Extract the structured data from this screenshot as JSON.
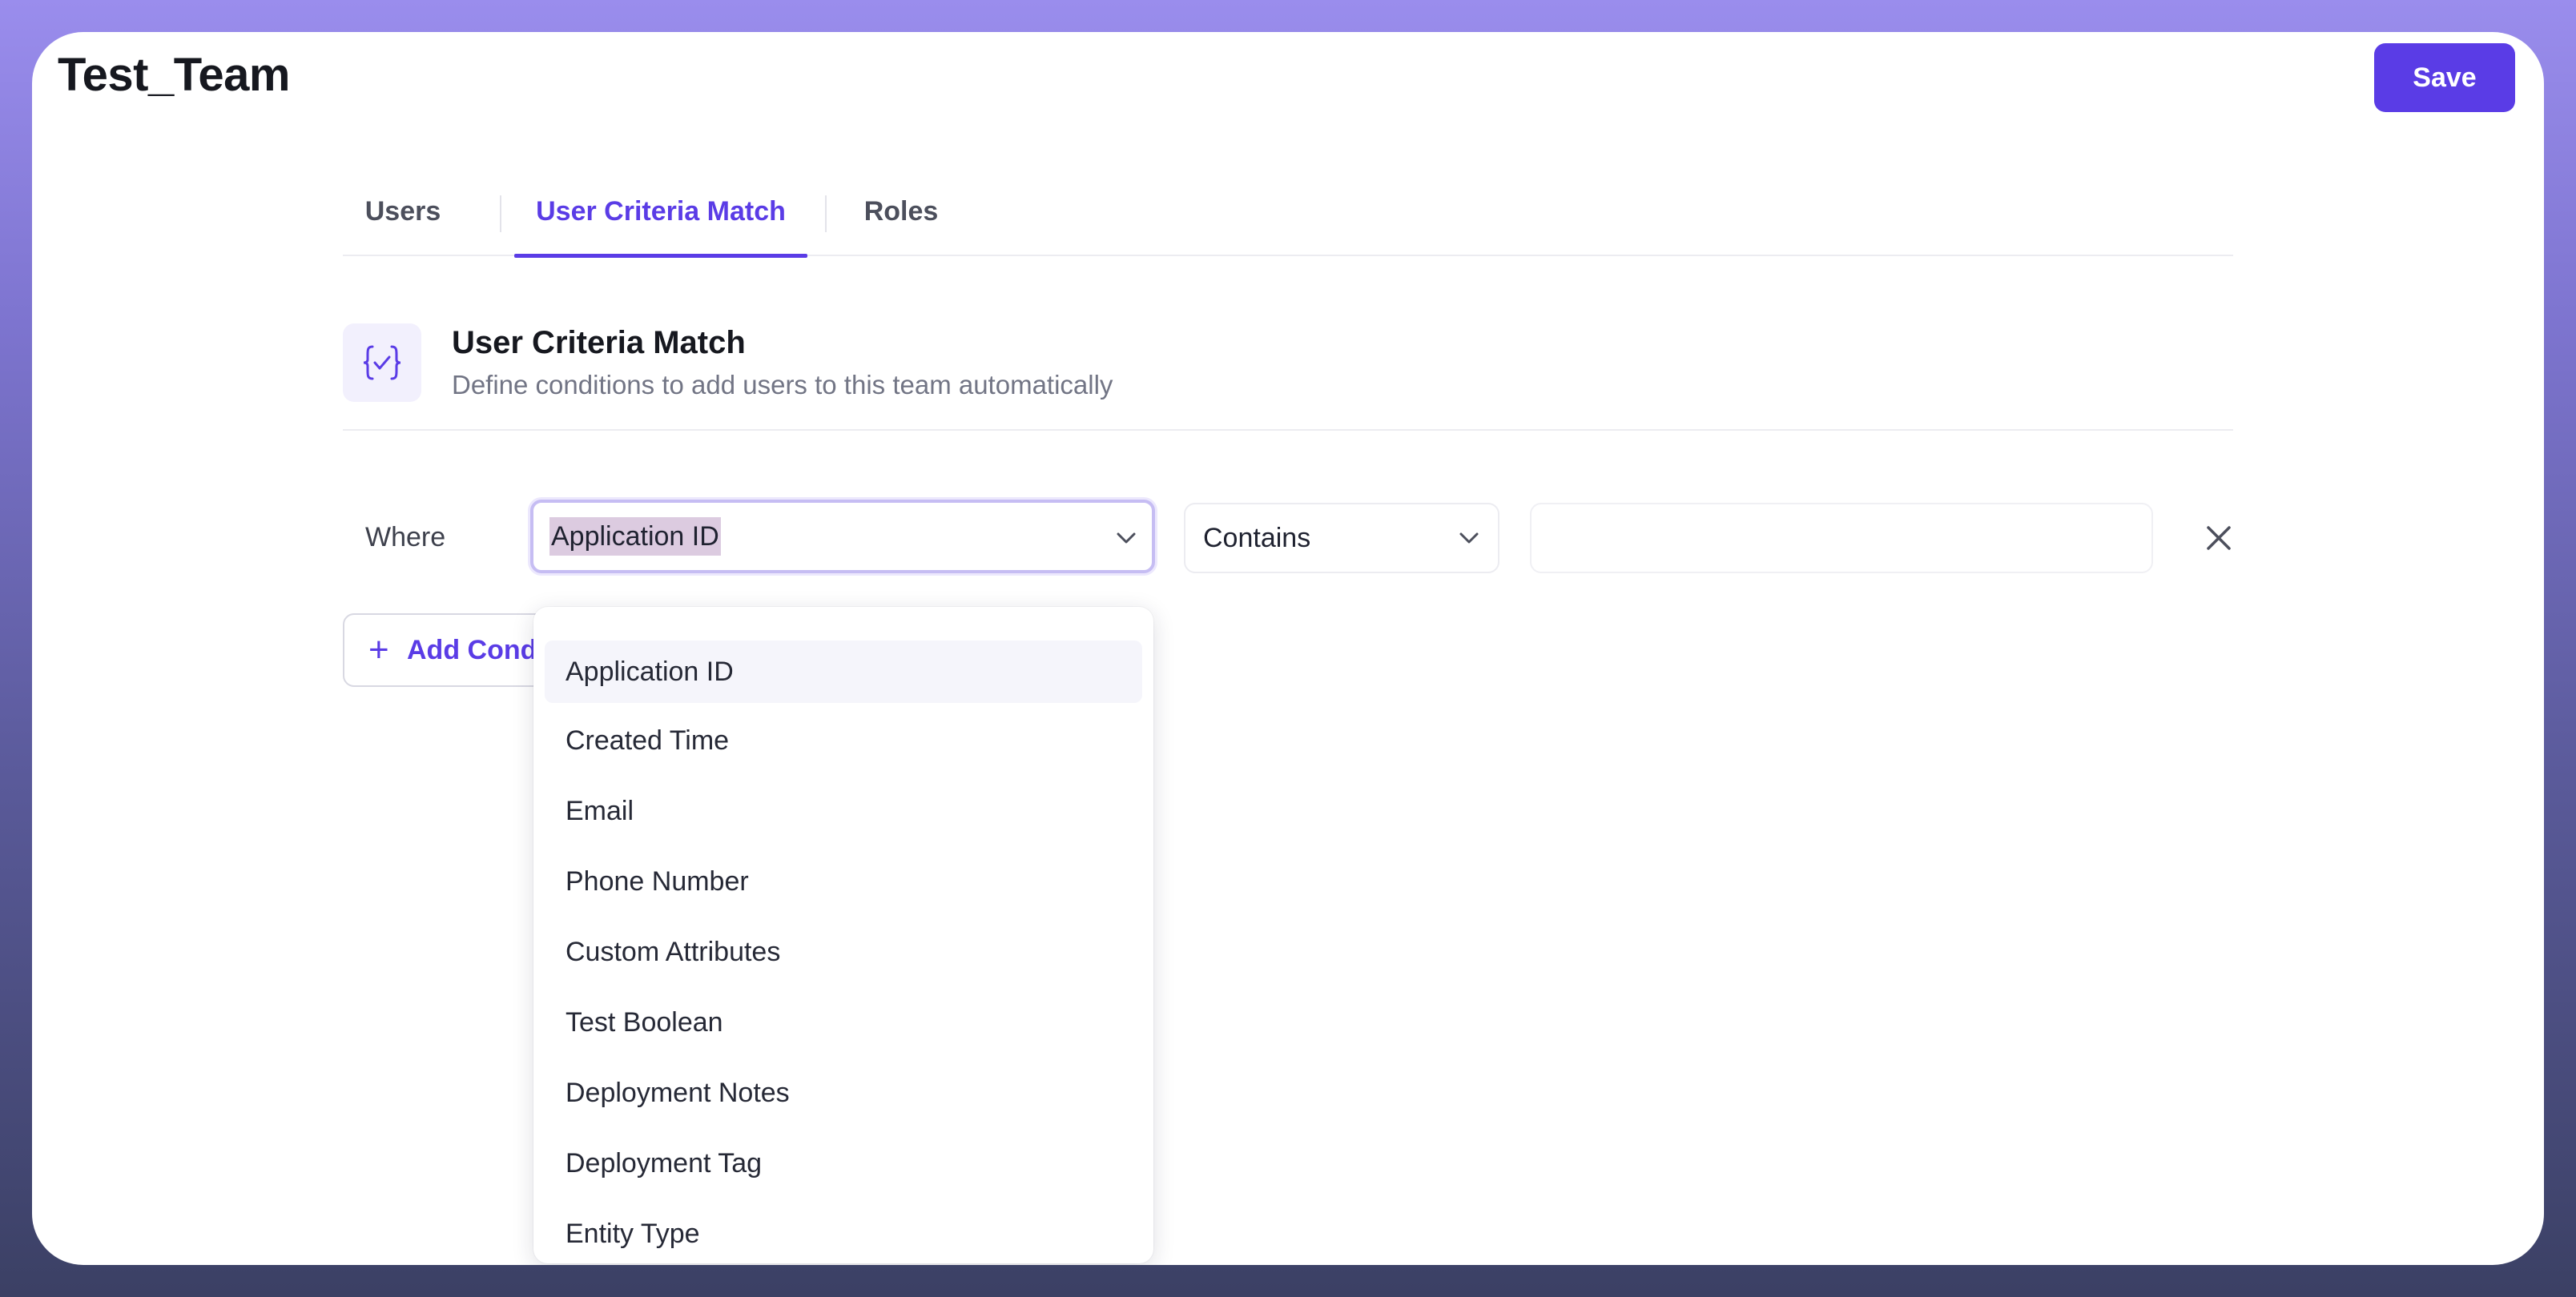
{
  "header": {
    "title": "Test_Team",
    "save_label": "Save"
  },
  "tabs": [
    {
      "label": "Users",
      "active": false
    },
    {
      "label": "User Criteria Match",
      "active": true
    },
    {
      "label": "Roles",
      "active": false
    }
  ],
  "section": {
    "icon": "curly-braces-check-icon",
    "title": "User Criteria Match",
    "subtitle": "Define conditions to add users to this team automatically"
  },
  "condition": {
    "where_label": "Where",
    "field_value": "Application ID",
    "operator_value": "Contains",
    "value_input": ""
  },
  "add_condition_label": "Add Condition",
  "dropdown": {
    "options": [
      "Application ID",
      "Created Time",
      "Email",
      "Phone Number",
      "Custom Attributes",
      "Test Boolean",
      "Deployment Notes",
      "Deployment Tag",
      "Entity Type"
    ]
  },
  "colors": {
    "accent": "#5a3ce6",
    "selection_highlight": "#dccbe0"
  }
}
